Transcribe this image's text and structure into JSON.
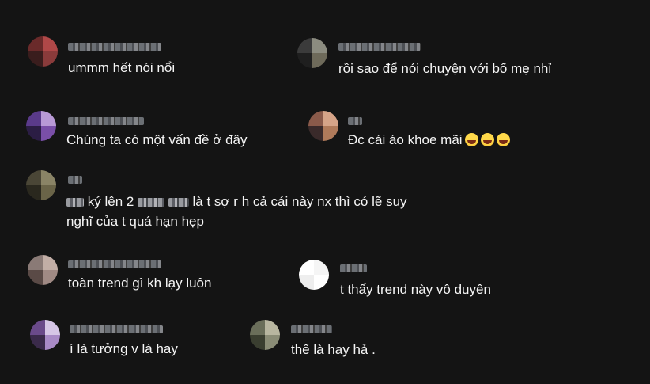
{
  "comments": [
    {
      "id": "c1",
      "text": "ummm hết nói nổi",
      "avatar_colors": [
        "#6a2a2a",
        "#b04848",
        "#3a1d1d",
        "#8a3b3b"
      ]
    },
    {
      "id": "c2",
      "text": "rồi sao để nói chuyện với bố mẹ nhỉ",
      "avatar_colors": [
        "#3b3b3b",
        "#8c8c80",
        "#1f1f1f",
        "#6e6a5a"
      ]
    },
    {
      "id": "c3",
      "text": "Chúng ta có một vấn đề ở đây",
      "avatar_colors": [
        "#5a3a8a",
        "#b99ad6",
        "#2b1d44",
        "#7a4fa8"
      ]
    },
    {
      "id": "c4",
      "text": "Đc cái áo khoe mãi",
      "emoji_count": 3,
      "avatar_colors": [
        "#8a5a4a",
        "#d6a488",
        "#3a2a2a",
        "#b07a5a"
      ]
    },
    {
      "id": "c5",
      "text_parts": [
        "ký lên 2",
        "là t sợ r h cả cái này nx thì có lẽ suy"
      ],
      "text_line2": "nghĩ của t quá hạn hẹp",
      "avatar_colors": [
        "#4a4636",
        "#8a8466",
        "#2a281e",
        "#6a6448"
      ]
    },
    {
      "id": "c6",
      "text": "toàn trend gì kh lạy luôn",
      "avatar_colors": [
        "#8a7a76",
        "#c2aea6",
        "#5a4a46",
        "#a08a84"
      ]
    },
    {
      "id": "c7",
      "text": "t thấy trend này vô duyên",
      "avatar_colors": [
        "#ffffff",
        "#f5f5f5",
        "#eeeeee",
        "#ffffff"
      ]
    },
    {
      "id": "c8",
      "text": "í là tưởng v là hay",
      "avatar_colors": [
        "#6a4a8a",
        "#d6c6e6",
        "#3a2a4a",
        "#a88ac6"
      ]
    },
    {
      "id": "c9",
      "text": "thế là hay hả .",
      "avatar_colors": [
        "#6a6e5a",
        "#b8b6a0",
        "#3a3e30",
        "#8a8c76"
      ]
    }
  ]
}
